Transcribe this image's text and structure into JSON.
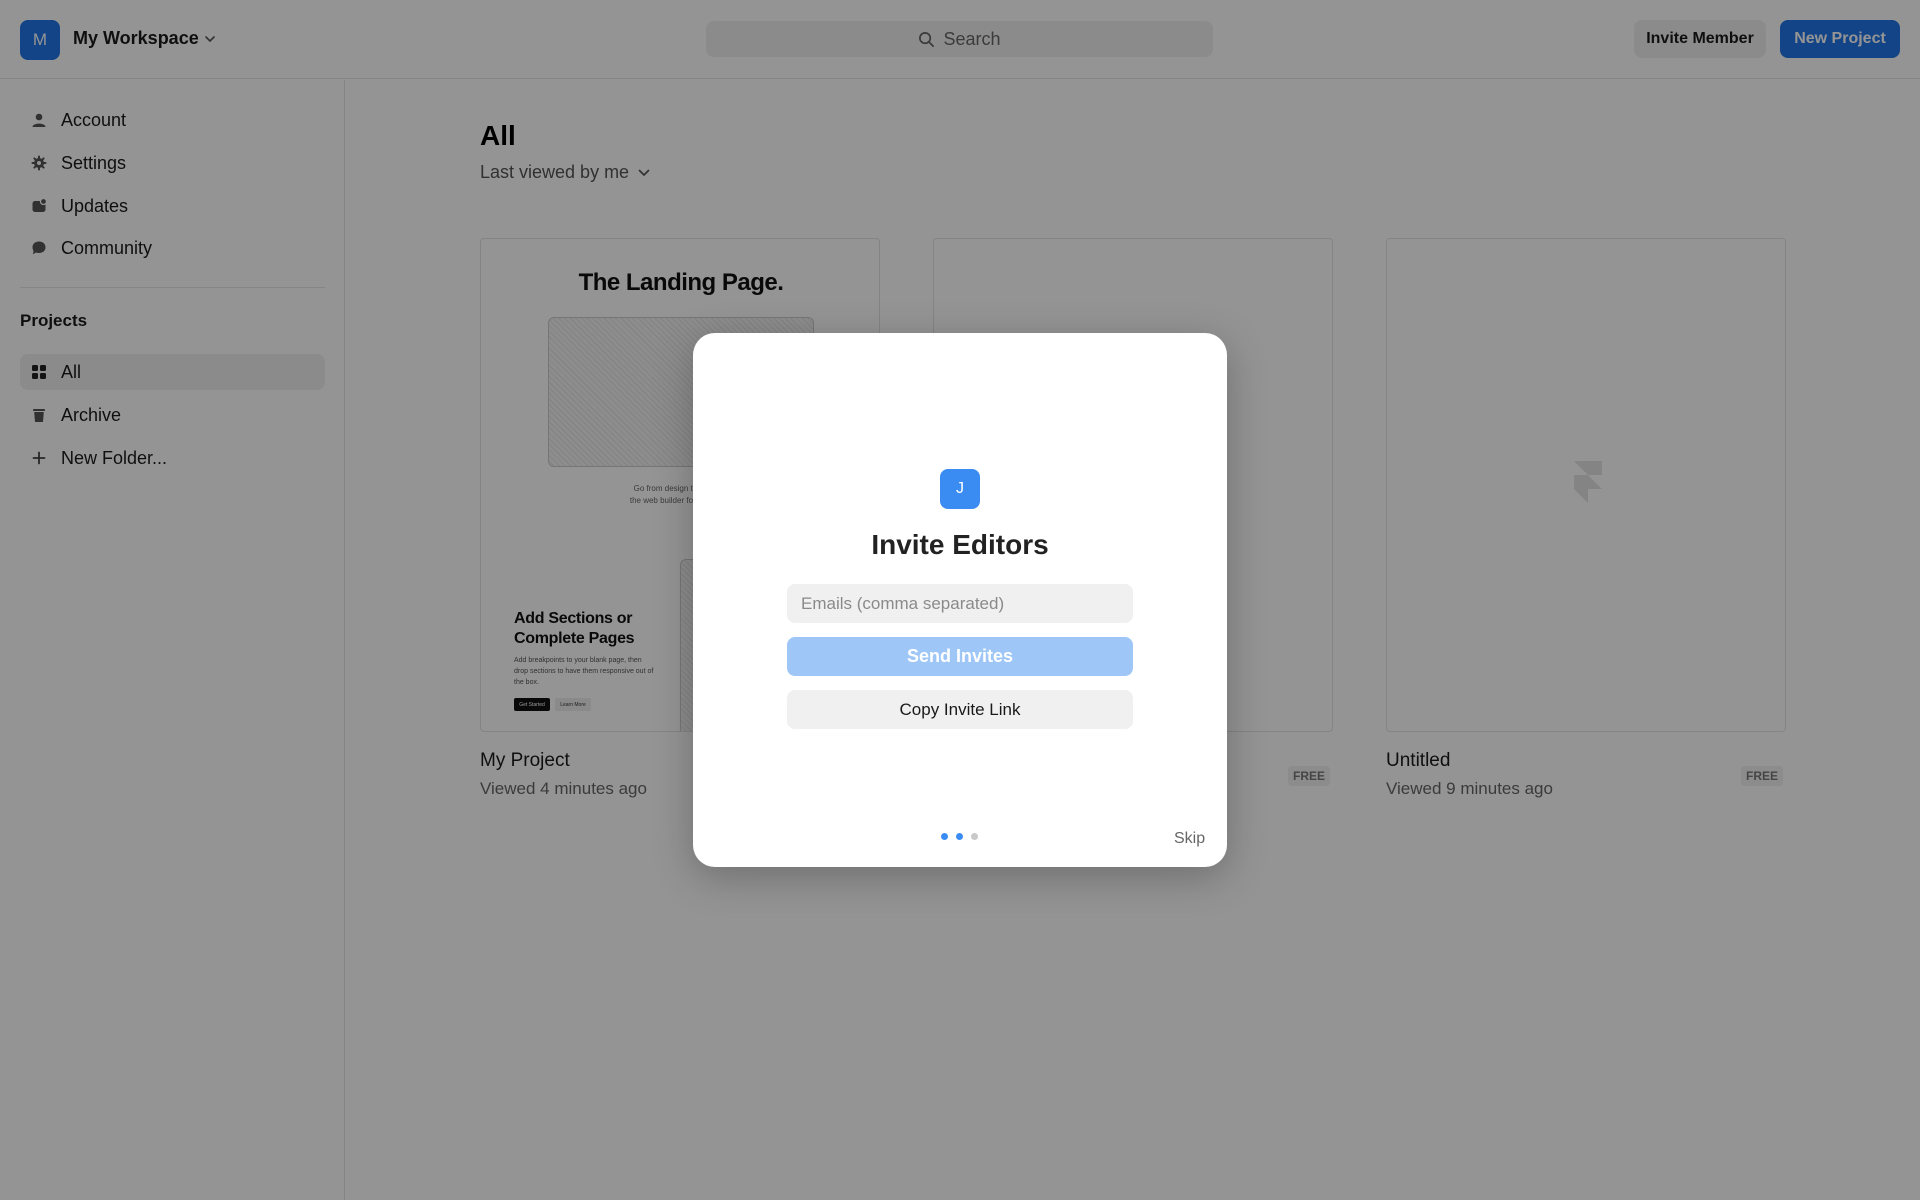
{
  "header": {
    "workspace_initial": "M",
    "workspace_name": "My Workspace",
    "search_label": "Search",
    "invite_member_label": "Invite Member",
    "new_project_label": "New Project"
  },
  "sidebar": {
    "items": [
      {
        "label": "Account",
        "icon": "user-icon"
      },
      {
        "label": "Settings",
        "icon": "gear-icon"
      },
      {
        "label": "Updates",
        "icon": "updates-icon"
      },
      {
        "label": "Community",
        "icon": "chat-bubble-icon"
      }
    ],
    "projects_heading": "Projects",
    "project_items": [
      {
        "label": "All",
        "icon": "grid-icon",
        "active": true
      },
      {
        "label": "Archive",
        "icon": "trash-icon"
      },
      {
        "label": "New Folder...",
        "icon": "plus-icon"
      }
    ]
  },
  "main": {
    "title": "All",
    "sort_label": "Last viewed by me",
    "cards": [
      {
        "title": "My Project",
        "subtitle": "Viewed 4 minutes ago",
        "thumbnail": {
          "heading": "The Landing Page.",
          "tagline_line1": "Go from design to site with",
          "tagline_line2": "the web builder for creatives.",
          "section_title": "Add Sections or Complete Pages",
          "section_body": "Add breakpoints to your blank page, then drop sections to have them responsive out of the box.",
          "primary_button": "Get Started",
          "secondary_button": "Learn More"
        }
      },
      {
        "title": "",
        "subtitle": "",
        "badge": "FREE"
      },
      {
        "title": "Untitled",
        "subtitle": "Viewed 9 minutes ago",
        "badge": "FREE",
        "thumbnail_icon": "framer-logo-icon"
      }
    ]
  },
  "modal": {
    "avatar_initial": "J",
    "title": "Invite Editors",
    "email_placeholder": "Emails (comma separated)",
    "send_label": "Send Invites",
    "copy_label": "Copy Invite Link",
    "skip_label": "Skip",
    "step_current": 2,
    "step_total": 3
  },
  "colors": {
    "accent": "#1f75e8",
    "send_disabled": "#9ec6f6",
    "dot_active": "#3a8cf2",
    "dot_inactive": "#c9c9c9"
  }
}
